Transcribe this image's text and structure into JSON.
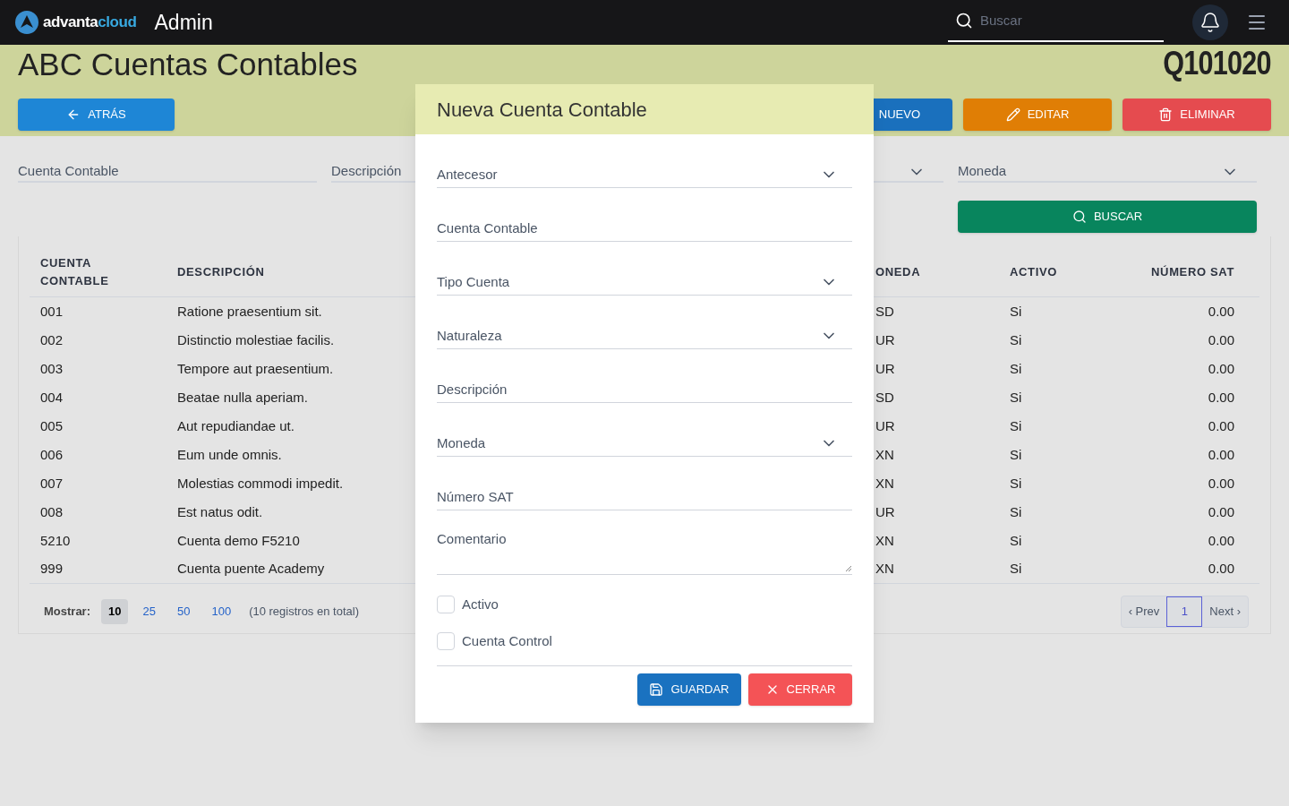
{
  "topbar": {
    "logo_text": "advanta",
    "logo_accent": "cloud",
    "app": "Admin",
    "search": {
      "placeholder": "Buscar"
    }
  },
  "page": {
    "title": "ABC Cuentas Contables",
    "code": "Q101020"
  },
  "actions": [
    {
      "kind": "back",
      "label": "ATRÁS"
    },
    {
      "kind": "new",
      "label": "NUEVO"
    },
    {
      "kind": "edit",
      "label": "EDITAR"
    },
    {
      "kind": "delete",
      "label": "ELIMINAR"
    }
  ],
  "filters": {
    "cuenta": {
      "placeholder": "Cuenta Contable"
    },
    "descripcion": {
      "placeholder": "Descripción"
    },
    "moneda": {
      "placeholder": "Moneda"
    },
    "search_button": "BUSCAR"
  },
  "table": {
    "columns": [
      "CUENTA CONTABLE",
      "DESCRIPCIÓN",
      "ONEDA",
      "ACTIVO",
      "NÚMERO SAT"
    ],
    "rows": [
      [
        "001",
        "Ratione praesentium sit.",
        "SD",
        "Si",
        "0.00"
      ],
      [
        "002",
        "Distinctio molestiae facilis.",
        "UR",
        "Si",
        "0.00"
      ],
      [
        "003",
        "Tempore aut praesentium.",
        "UR",
        "Si",
        "0.00"
      ],
      [
        "004",
        "Beatae nulla aperiam.",
        "SD",
        "Si",
        "0.00"
      ],
      [
        "005",
        "Aut repudiandae ut.",
        "UR",
        "Si",
        "0.00"
      ],
      [
        "006",
        "Eum unde omnis.",
        "XN",
        "Si",
        "0.00"
      ],
      [
        "007",
        "Molestias commodi impedit.",
        "XN",
        "Si",
        "0.00"
      ],
      [
        "008",
        "Est natus odit.",
        "UR",
        "Si",
        "0.00"
      ],
      [
        "5210",
        "Cuenta demo F5210",
        "XN",
        "Si",
        "0.00"
      ],
      [
        "999",
        "Cuenta puente Academy",
        "XN",
        "Si",
        "0.00"
      ]
    ]
  },
  "footer": {
    "label": "Mostrar:",
    "page_sizes": [
      {
        "label": "10",
        "selected": true
      },
      {
        "label": "25",
        "selected": false
      },
      {
        "label": "50",
        "selected": false
      },
      {
        "label": "100",
        "selected": false
      }
    ],
    "total": "(10 registros en total)",
    "pagination": {
      "prev": "‹ Prev",
      "pages": [
        {
          "label": "1",
          "selected": true
        }
      ],
      "next": "Next ›"
    }
  },
  "modal": {
    "title": "Nueva Cuenta Contable",
    "fields": [
      {
        "kind": "select",
        "placeholder": "Antecesor"
      },
      {
        "kind": "text",
        "placeholder": "Cuenta Contable"
      },
      {
        "kind": "select",
        "placeholder": "Tipo Cuenta"
      },
      {
        "kind": "select",
        "placeholder": "Naturaleza"
      },
      {
        "kind": "text",
        "placeholder": "Descripción"
      },
      {
        "kind": "select",
        "placeholder": "Moneda"
      },
      {
        "kind": "text",
        "placeholder": "Número SAT"
      },
      {
        "kind": "textarea",
        "placeholder": "Comentario"
      }
    ],
    "checkboxes": [
      {
        "label": "Activo",
        "checked": false
      },
      {
        "label": "Cuenta Control",
        "checked": false
      }
    ],
    "buttons": [
      {
        "kind": "save",
        "label": "GUARDAR"
      },
      {
        "kind": "close",
        "label": "CERRAR"
      }
    ]
  }
}
